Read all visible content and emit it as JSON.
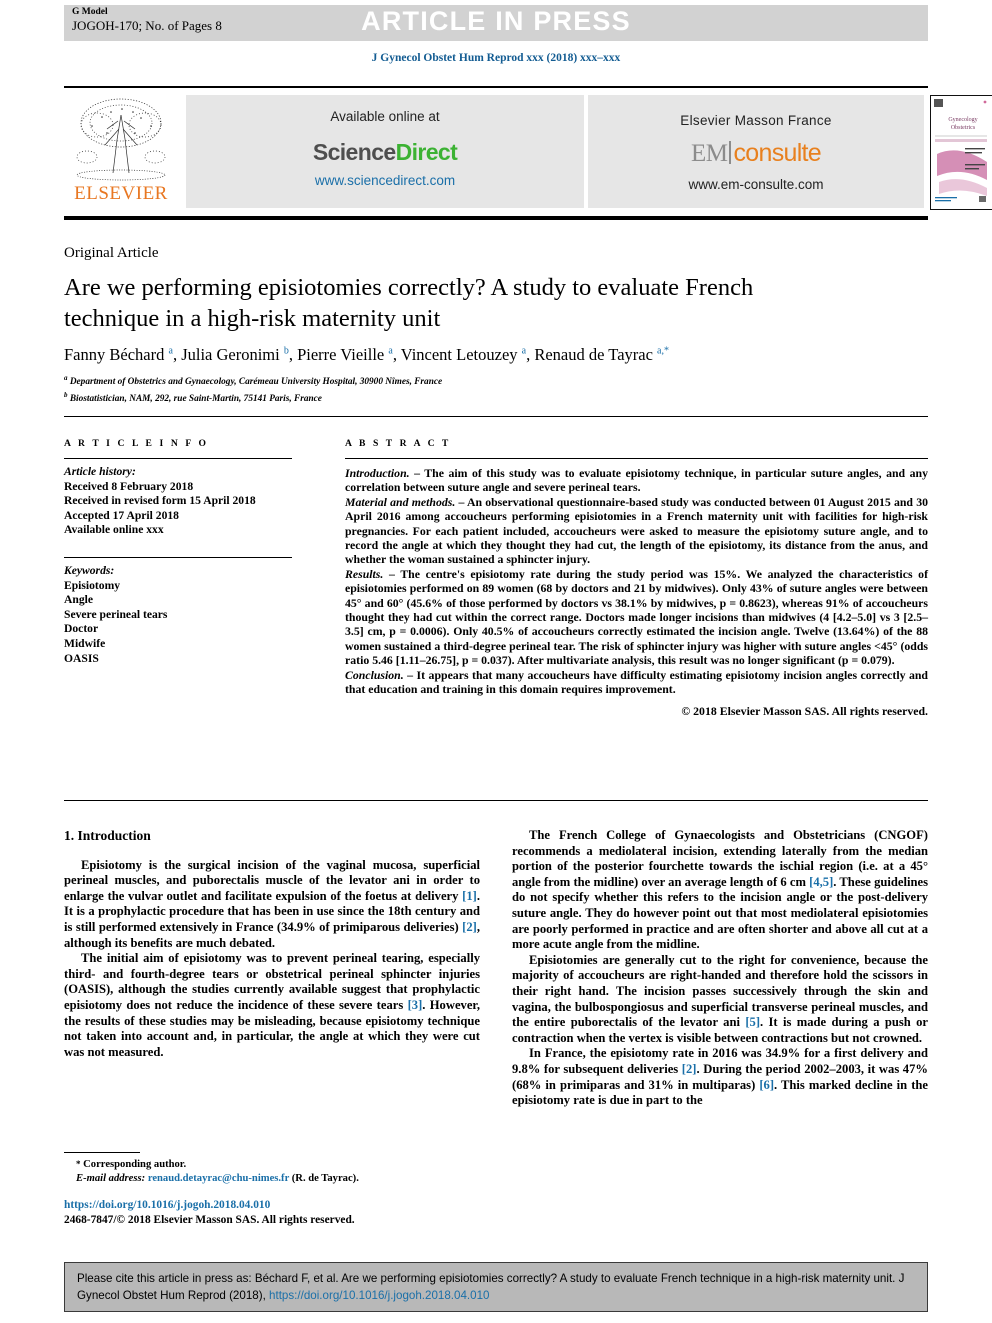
{
  "header": {
    "g_model_line1": "G Model",
    "g_model_line2": "JOGOH-170; No. of Pages 8",
    "article_in_press": "ARTICLE IN PRESS",
    "journal_ref": "J Gynecol Obstet Hum Reprod xxx (2018) xxx–xxx"
  },
  "publisher_strip": {
    "elsevier_label": "ELSEVIER",
    "available_online": "Available online at",
    "sciencedirect_part1": "Science",
    "sciencedirect_part2": "Direct",
    "sciencedirect_url": "www.sciencedirect.com",
    "masson_label": "Elsevier Masson France",
    "em_part1": "EM",
    "em_part2": "consulte",
    "em_url": "www.em-consulte.com",
    "cover_title_line1": "Gynecology",
    "cover_title_line2": "Obstetrics"
  },
  "article": {
    "type": "Original Article",
    "title": "Are we performing episiotomies correctly? A study to evaluate French technique in a high-risk maternity unit",
    "authors_html": "Fanny Béchard <sup>a</sup>, Julia Geronimi <sup>b</sup>, Pierre Vieille <sup>a</sup>, Vincent Letouzey <sup>a</sup>, Renaud de Tayrac <sup>a,*</sup>",
    "affiliation_a": "Department of Obstetrics and Gynaecology, Carémeau University Hospital, 30900 Nîmes, France",
    "affiliation_b": "Biostatistician, NAM, 292, rue Saint-Martin, 75141 Paris, France"
  },
  "article_info": {
    "label": "A R T I C L E  I N F O",
    "history_label": "Article history:",
    "history": [
      "Received 8 February 2018",
      "Received in revised form 15 April 2018",
      "Accepted 17 April 2018",
      "Available online xxx"
    ],
    "keywords_label": "Keywords:",
    "keywords": [
      "Episiotomy",
      "Angle",
      "Severe perineal tears",
      "Doctor",
      "Midwife",
      "OASIS"
    ]
  },
  "abstract": {
    "label": "A B S T R A C T",
    "sections": [
      {
        "lead": "Introduction.",
        "text": " – The aim of this study was to evaluate episiotomy technique, in particular suture angles, and any correlation between suture angle and severe perineal tears."
      },
      {
        "lead": "Material and methods.",
        "text": " – An observational questionnaire-based study was conducted between 01 August 2015 and 30 April 2016 among accoucheurs performing episiotomies in a French maternity unit with facilities for high-risk pregnancies. For each patient included, accoucheurs were asked to measure the episiotomy suture angle, and to record the angle at which they thought they had cut, the length of the episiotomy, its distance from the anus, and whether the woman sustained a sphincter injury."
      },
      {
        "lead": "Results.",
        "text": " – The centre's episiotomy rate during the study period was 15%. We analyzed the characteristics of episiotomies performed on 89 women (68 by doctors and 21 by midwives). Only 43% of suture angles were between 45° and 60° (45.6% of those performed by doctors vs 38.1% by midwives, p = 0.8623), whereas 91% of accoucheurs thought they had cut within the correct range. Doctors made longer incisions than midwives (4 [4.2–5.0] vs 3 [2.5–3.5] cm, p = 0.0006). Only 40.5% of accoucheurs correctly estimated the incision angle. Twelve (13.64%) of the 88 women sustained a third-degree perineal tear. The risk of sphincter injury was higher with suture angles <45° (odds ratio 5.46 [1.11–26.75], p = 0.037). After multivariate analysis, this result was no longer significant (p = 0.079)."
      },
      {
        "lead": "Conclusion.",
        "text": " – It appears that many accoucheurs have difficulty estimating episiotomy incision angles correctly and that education and training in this domain requires improvement."
      }
    ],
    "copyright": "© 2018 Elsevier Masson SAS. All rights reserved."
  },
  "body": {
    "section_heading": "1. Introduction",
    "left_paragraphs": [
      "Episiotomy is the surgical incision of the vaginal mucosa, superficial perineal muscles, and puborectalis muscle of the levator ani in order to enlarge the vulvar outlet and facilitate expulsion of the foetus at delivery [1]. It is a prophylactic procedure that has been in use since the 18th century and is still performed extensively in France (34.9% of primiparous deliveries) [2], although its benefits are much debated.",
      "The initial aim of episiotomy was to prevent perineal tearing, especially third- and fourth-degree tears or obstetrical perineal sphincter injuries (OASIS), although the studies currently available suggest that prophylactic episiotomy does not reduce the incidence of these severe tears [3]. However, the results of these studies may be misleading, because episiotomy technique not taken into account and, in particular, the angle at which they were cut was not measured."
    ],
    "right_paragraphs": [
      "The French College of Gynaecologists and Obstetricians (CNGOF) recommends a mediolateral incision, extending laterally from the median portion of the posterior fourchette towards the ischial region (i.e. at a 45° angle from the midline) over an average length of 6 cm [4,5]. These guidelines do not specify whether this refers to the incision angle or the post-delivery suture angle. They do however point out that most mediolateral episiotomies are poorly performed in practice and are often shorter and above all cut at a more acute angle from the midline.",
      "Episiotomies are generally cut to the right for convenience, because the majority of accoucheurs are right-handed and therefore hold the scissors in their right hand. The incision passes successively through the skin and vagina, the bulbospongiosus and superficial transverse perineal muscles, and the entire puborectalis of the levator ani [5]. It is made during a push or contraction when the vertex is visible between contractions but not crowned.",
      "In France, the episiotomy rate in 2016 was 34.9% for a first delivery and 9.8% for subsequent deliveries [2]. During the period 2002–2003, it was 47% (68% in primiparas and 31% in multiparas) [6]. This marked decline in the episiotomy rate is due in part to the"
    ]
  },
  "footnote": {
    "corresponding": "Corresponding author.",
    "email_label": "E-mail address:",
    "email": "renaud.detayrac@chu-nimes.fr",
    "email_suffix": "(R. de Tayrac).",
    "doi": "https://doi.org/10.1016/j.jogoh.2018.04.010",
    "issn_line": "2468-7847/© 2018 Elsevier Masson SAS. All rights reserved."
  },
  "citation_footer": {
    "text_part1": "Please cite this article in press as: Béchard F, et al. Are we performing episiotomies correctly? A study to evaluate French technique in a high-risk maternity unit. J Gynecol Obstet Hum Reprod (2018), ",
    "link": "https://doi.org/10.1016/j.jogoh.2018.04.010"
  },
  "colors": {
    "journal_blue": "#135c92",
    "link_blue": "#1a6fa8",
    "elsevier_orange": "#e87722",
    "sciencedirect_green": "#3cb233",
    "banner_grey": "#d2d2d2",
    "footer_grey": "#b8b8b8"
  }
}
